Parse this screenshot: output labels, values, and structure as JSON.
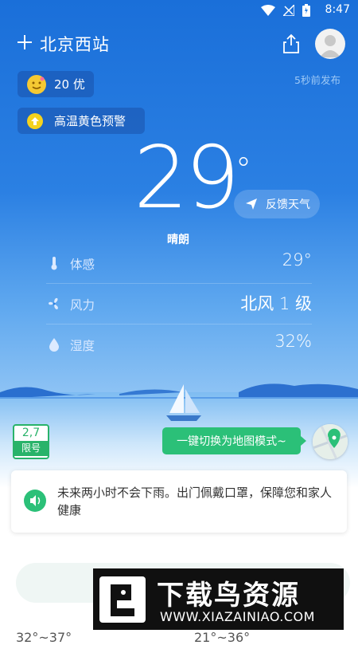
{
  "status_bar": {
    "time": "8:47"
  },
  "header": {
    "city": "北京西站",
    "publish_time": "5秒前发布"
  },
  "aqi": {
    "value": "20 优"
  },
  "warning": {
    "text": "高温黄色预警"
  },
  "current": {
    "temp": "29",
    "unit": "°",
    "condition": "晴朗",
    "feedback_label": "反馈天气"
  },
  "details": [
    {
      "label": "体感",
      "value": "29°",
      "icon": "thermometer-icon"
    },
    {
      "label": "风力",
      "value": "北风 1 级",
      "icon": "fan-icon"
    },
    {
      "label": "湿度",
      "value": "32%",
      "icon": "droplet-icon"
    }
  ],
  "traffic_limit": {
    "numbers": "2,7",
    "label": "限号"
  },
  "map_tip": {
    "text": "一键切换为地图模式~"
  },
  "forecast": {
    "text": "未来两小时不会下雨。出门佩戴口罩，保障您和家人健康"
  },
  "bottom": {
    "temps_left": "32°~37°",
    "temps_right": "21°~36°"
  },
  "watermark": {
    "title": "下载鸟资源",
    "url": "WWW.XIAZAINIAO.COM"
  },
  "colors": {
    "accent_green": "#2bc078",
    "sky_blue": "#1a6fd9",
    "warning_yellow": "#f5d21d"
  }
}
